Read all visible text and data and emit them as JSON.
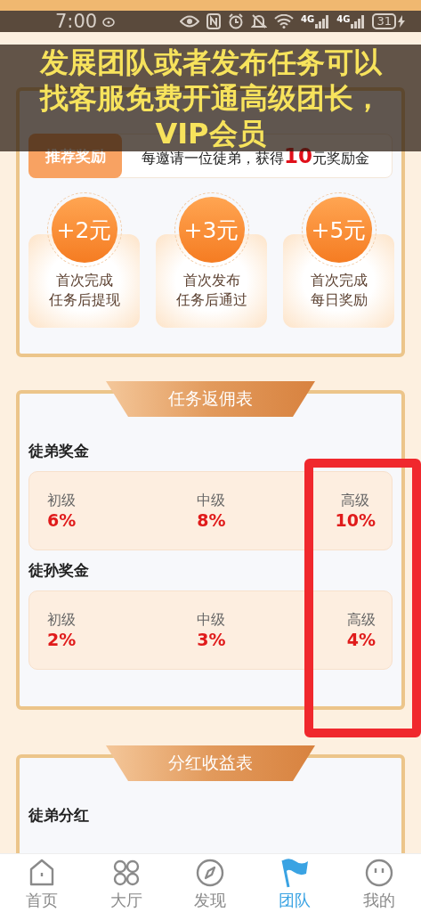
{
  "status_bar": {
    "time": "7:00",
    "network": [
      "4G",
      "4G"
    ],
    "battery": "31"
  },
  "caption": "发展团队或者发布任务可以找客服免费开通高级团长，VIP会员",
  "referral": {
    "badge": "推荐奖励",
    "text": "每邀请一位徒弟，获得**10**元奖励金"
  },
  "rewards": [
    {
      "amount": "+2元",
      "description": [
        "首次完成",
        "任务后提现"
      ]
    },
    {
      "amount": "+3元",
      "description": [
        "首次发布",
        "任务后通过"
      ]
    },
    {
      "amount": "+5元",
      "description": [
        "首次完成",
        "每日奖励"
      ]
    }
  ],
  "commission_table": {
    "title": "任务返佣表",
    "groups": [
      {
        "title": "徒弟奖金",
        "levels": [
          {
            "label": "初级",
            "rate": "6%"
          },
          {
            "label": "中级",
            "rate": "8%"
          },
          {
            "label": "高级",
            "rate": "10%"
          }
        ]
      },
      {
        "title": "徒孙奖金",
        "levels": [
          {
            "label": "初级",
            "rate": "2%"
          },
          {
            "label": "中级",
            "rate": "3%"
          },
          {
            "label": "高级",
            "rate": "4%"
          }
        ]
      }
    ]
  },
  "dividend_table": {
    "title": "分红收益表",
    "groups": [
      {
        "title": "徒弟分红"
      }
    ]
  },
  "nav": [
    {
      "label": "首页",
      "selected": false
    },
    {
      "label": "大厅",
      "selected": false
    },
    {
      "label": "发现",
      "selected": false
    },
    {
      "label": "团队",
      "selected": true
    },
    {
      "label": "我的",
      "selected": false
    }
  ]
}
